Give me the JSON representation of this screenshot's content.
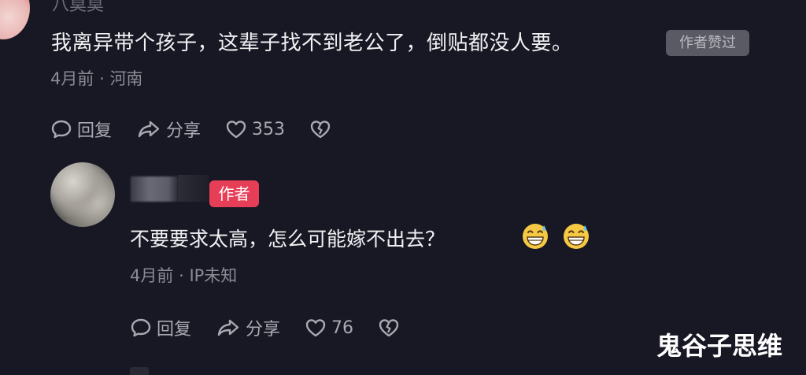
{
  "comment": {
    "user_name": "八莫莫",
    "text": "我离异带个孩子，这辈子找不到老公了，倒贴都没人要。",
    "liked_badge": "作者赞过",
    "time": "4月前",
    "location": "河南",
    "reply_label": "回复",
    "share_label": "分享",
    "like_count": "353"
  },
  "reply": {
    "author_badge": "作者",
    "text": "不要要求太高，怎么可能嫁不出去？",
    "emojis": [
      "grinning-sweat-emoji",
      "grinning-sweat-emoji"
    ],
    "time": "4月前",
    "location": "IP未知",
    "reply_label": "回复",
    "share_label": "分享",
    "like_count": "76"
  },
  "meta_separator": "·",
  "watermark": "鬼谷子思维",
  "colors": {
    "background": "#181824",
    "author_badge": "#e73e58",
    "liked_badge": "#595a63"
  }
}
